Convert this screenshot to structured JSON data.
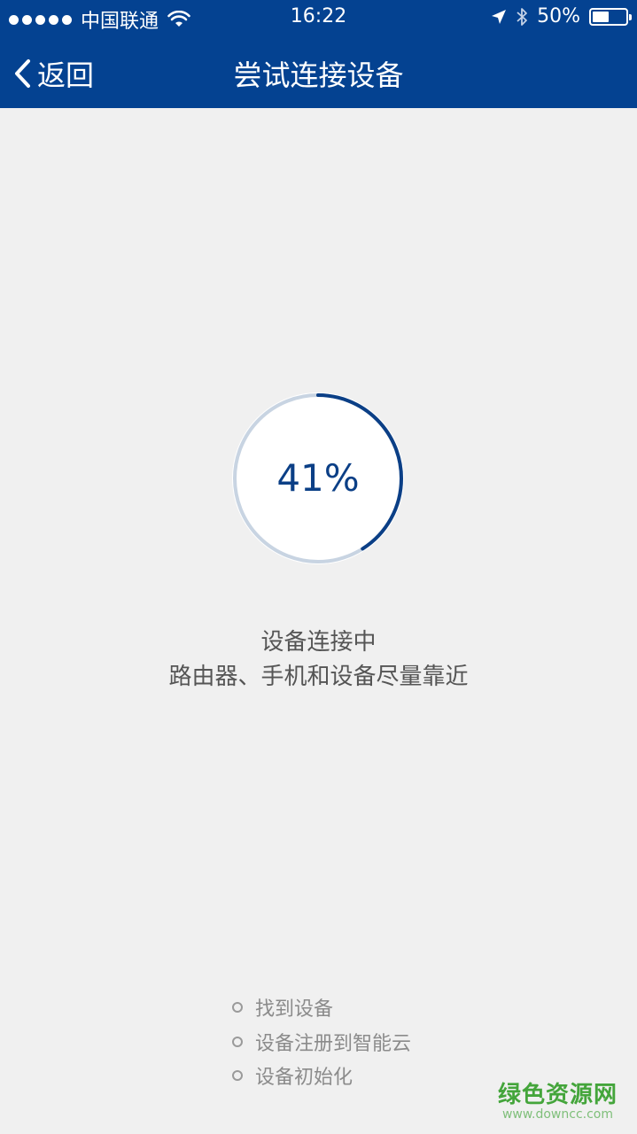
{
  "status_bar": {
    "carrier": "中国联通",
    "time": "16:22",
    "battery_percent": "50%",
    "battery_level": 0.5,
    "icons": [
      "signal-dots-icon",
      "wifi-icon",
      "location-arrow-icon",
      "bluetooth-icon",
      "battery-icon"
    ]
  },
  "nav": {
    "back_label": "返回",
    "back_icon": "chevron-left-icon",
    "title": "尝试连接设备"
  },
  "progress": {
    "label": "41%",
    "value": 0.41,
    "track_color": "#c8d4e2",
    "fill_color": "#0b3f86"
  },
  "message": {
    "line1": "设备连接中",
    "line2": "路由器、手机和设备尽量靠近"
  },
  "steps": [
    {
      "label": "找到设备",
      "icon": "circle-bullet-icon"
    },
    {
      "label": "设备注册到智能云",
      "icon": "circle-bullet-icon"
    },
    {
      "label": "设备初始化",
      "icon": "circle-bullet-icon"
    }
  ],
  "watermark": {
    "main": "绿色资源网",
    "sub": "www.downcc.com"
  },
  "colors": {
    "header_bg": "#044291",
    "page_bg": "#f0f0f0",
    "accent": "#0b3f86"
  }
}
